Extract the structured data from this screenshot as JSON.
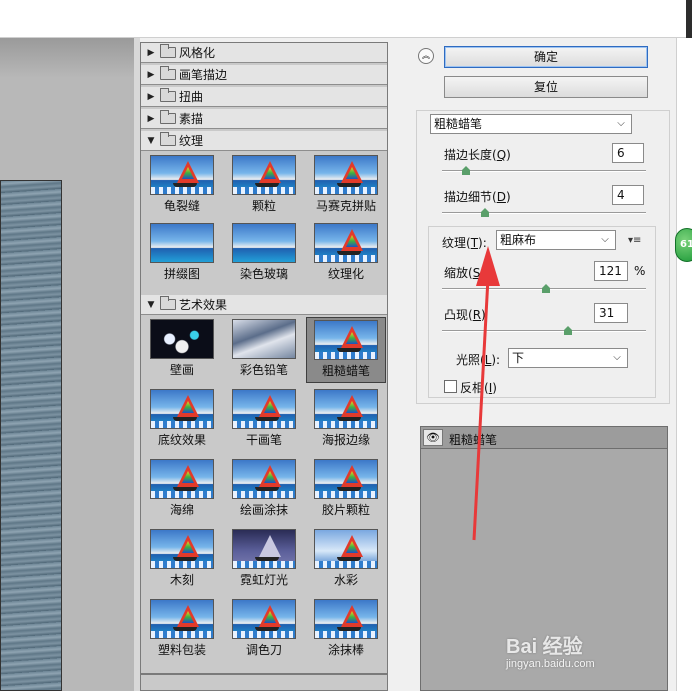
{
  "dialog": {
    "categories_top": [
      "风格化",
      "画笔描边",
      "扭曲",
      "素描"
    ],
    "texture_category": "纹理",
    "texture_filters": [
      "龟裂缝",
      "颗粒",
      "马赛克拼贴",
      "拼缀图",
      "染色玻璃",
      "纹理化"
    ],
    "artistic_category": "艺术效果",
    "artistic_filters": [
      "壁画",
      "彩色铅笔",
      "粗糙蜡笔",
      "底纹效果",
      "干画笔",
      "海报边缘",
      "海绵",
      "绘画涂抹",
      "胶片颗粒",
      "木刻",
      "霓虹灯光",
      "水彩",
      "塑料包装",
      "调色刀",
      "涂抹棒"
    ],
    "selected_filter": "粗糙蜡笔"
  },
  "panel": {
    "ok_label": "确定",
    "reset_label": "复位",
    "filter_select": "粗糙蜡笔",
    "stroke_length_label": "描边长度(",
    "stroke_length_key": "Q",
    "stroke_length_value": "6",
    "stroke_length_level": 0.1,
    "stroke_detail_label": "描边细节(",
    "stroke_detail_key": "D",
    "stroke_detail_value": "4",
    "stroke_detail_level": 0.2,
    "texture_label": "纹理(",
    "texture_key": "T",
    "texture_value": "粗麻布",
    "scaling_label": "缩放(",
    "scaling_key": "S",
    "scaling_value": "121",
    "scaling_unit": "%",
    "scaling_level": 0.51,
    "relief_label": "凸现(",
    "relief_key": "R",
    "relief_value": "31",
    "relief_level": 0.62,
    "light_label": "光照(",
    "light_key": "L",
    "light_value": "下",
    "invert_label": "反相(",
    "invert_key": "I",
    "layer_name": "粗糙蜡笔"
  },
  "side_badge": "61",
  "watermark": {
    "logo": "Bai 经验",
    "url": "jingyan.baidu.com"
  },
  "colors": {
    "arrow": "#e8393a",
    "primary_border": "#2f6bc0",
    "slider_knob": "#5a9f6a"
  }
}
